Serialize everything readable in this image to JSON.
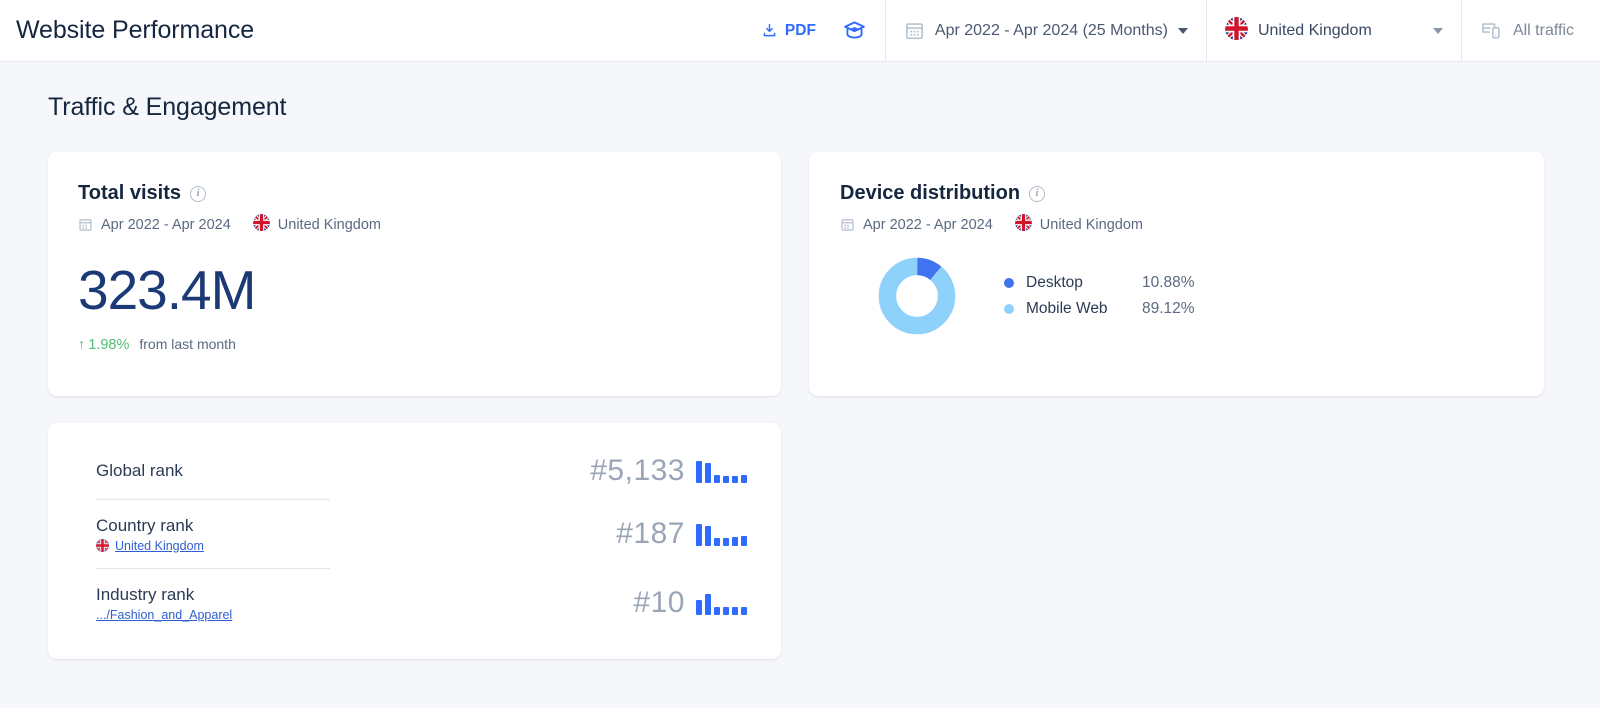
{
  "header": {
    "title": "Website Performance",
    "pdf_label": "PDF",
    "pdf_icon": "download-icon",
    "academy_icon": "graduation-cap-icon",
    "date_range": "Apr 2022 - Apr 2024 (25 Months)",
    "date_icon": "calendar-icon",
    "country": "United Kingdom",
    "country_flag": "uk-flag-icon",
    "traffic_filter": "All traffic",
    "traffic_icon": "devices-icon"
  },
  "section": {
    "title": "Traffic & Engagement"
  },
  "total_visits": {
    "title": "Total visits",
    "info_icon": "info-icon",
    "date_range": "Apr 2022 - Apr 2024",
    "country": "United Kingdom",
    "value": "323.4M",
    "delta_arrow": "↑",
    "delta": "1.98%",
    "delta_caption": "from last month"
  },
  "device_distribution": {
    "title": "Device distribution",
    "info_icon": "info-icon",
    "date_range": "Apr 2022 - Apr 2024",
    "country": "United Kingdom",
    "legend": [
      {
        "name": "Desktop",
        "value": "10.88%",
        "color": "#3f73ef"
      },
      {
        "name": "Mobile Web",
        "value": "89.12%",
        "color": "#8ed2fb"
      }
    ]
  },
  "ranks": [
    {
      "label": "Global rank",
      "sub_link": null,
      "sub_flag": null,
      "value": "#5,133",
      "spark": [
        22,
        20,
        8,
        7,
        7,
        8
      ]
    },
    {
      "label": "Country rank",
      "sub_link": "United Kingdom",
      "sub_flag": "uk-flag-icon",
      "value": "#187",
      "spark": [
        22,
        20,
        8,
        8,
        9,
        10
      ]
    },
    {
      "label": "Industry rank",
      "sub_link": ".../Fashion_and_Apparel",
      "sub_flag": null,
      "value": "#10",
      "spark": [
        15,
        21,
        8,
        8,
        8,
        8
      ]
    }
  ],
  "chart_data": {
    "type": "pie",
    "title": "Device distribution",
    "categories": [
      "Desktop",
      "Mobile Web"
    ],
    "values": [
      10.88,
      89.12
    ],
    "colors": [
      "#3f73ef",
      "#8ed2fb"
    ],
    "units": "%",
    "legend_position": "right",
    "donut": true
  },
  "theme": {
    "accent": "#2f6bff",
    "page_bg": "#f5f7fa",
    "card_bg": "#ffffff",
    "text_dark": "#15263f",
    "text_muted": "#5b6a80",
    "positive": "#4fbf6f",
    "rank_value": "#9aa5b5",
    "big_number": "#1b3a75"
  }
}
